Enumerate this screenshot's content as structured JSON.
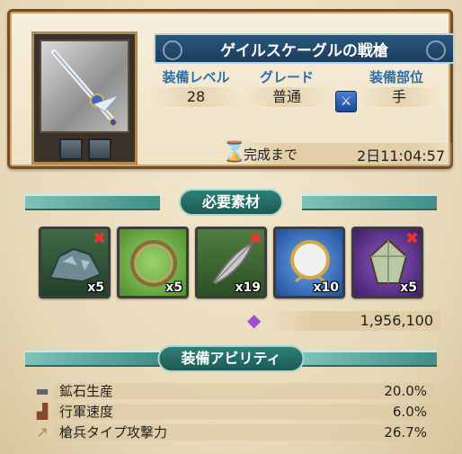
{
  "item": {
    "name": "ゲイルスケーグルの戦槍",
    "icon": "spear-icon"
  },
  "stats": {
    "level_label": "装備レベル",
    "level_value": "28",
    "grade_label": "グレード",
    "grade_value": "普通",
    "slot_label": "装備部位",
    "slot_value": "手"
  },
  "timer": {
    "label": "完成まで",
    "value": "2日11:04:57"
  },
  "materials": {
    "header": "必要素材",
    "items": [
      {
        "icon": "ore-rock-icon",
        "count": "x5",
        "missing": true,
        "missing_mark": "✖",
        "color": "#2e4b33"
      },
      {
        "icon": "wreath-ring-icon",
        "count": "x5",
        "missing": false,
        "missing_mark": "",
        "color": "#5fa13a"
      },
      {
        "icon": "feather-icon",
        "count": "x19",
        "missing": true,
        "missing_mark": "✖",
        "color": "#3d6a36"
      },
      {
        "icon": "mirror-icon",
        "count": "x10",
        "missing": false,
        "missing_mark": "",
        "color": "#2f64b8"
      },
      {
        "icon": "crystal-icon",
        "count": "x5",
        "missing": true,
        "missing_mark": "✖",
        "color": "#5b2e86"
      }
    ],
    "cost_icon": "gem-icon",
    "cost_value": "1,956,100"
  },
  "abilities": {
    "header": "装備アビリティ",
    "rows": [
      {
        "icon": "anvil-icon",
        "name": "鉱石生産",
        "value": "20.0%"
      },
      {
        "icon": "boot-icon",
        "name": "行軍速度",
        "value": "6.0%"
      },
      {
        "icon": "spear-icon",
        "name": "槍兵タイプ攻撃力",
        "value": "26.7%"
      }
    ]
  }
}
